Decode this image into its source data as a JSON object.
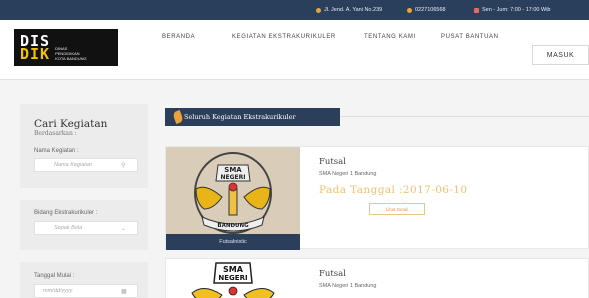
{
  "topbar": {
    "address": "Jl. Jend. A. Yani No.239",
    "phone": "0227106568",
    "hours": "Sen - Jum: 7:00 - 17:00 Wib"
  },
  "logo": {
    "mark_line1": "DIS",
    "mark_line2": "DIK",
    "text_line1": "Dinas",
    "text_line2": "Pendidikan",
    "text_line3": "Kota Bandung"
  },
  "nav": {
    "items": [
      "BERANDA",
      "KEGIATAN EKSTRAKURIKULER",
      "TENTANG KAMI",
      "PUSAT BANTUAN"
    ],
    "login_label": "MASUK"
  },
  "sidebar": {
    "title": "Cari Kegiatan",
    "subtitle": "Berdasarkan :",
    "name_label": "Nama Kegiatan :",
    "name_placeholder": "Nama Kegiatan",
    "field_label": "Bidang Ekstrakurikuler :",
    "field_value": "Sepak Bola",
    "date_label": "Tanggal Mulai :",
    "date_placeholder": "mm/dd/yyyy"
  },
  "section": {
    "title": "Seluruh Kegiatan Ekstrakurikuler"
  },
  "cards": [
    {
      "title": "Futsal",
      "school": "SMA Negeri 1 Bandung",
      "date_text": "Pada Tanggal :2017-06-10",
      "button": "Lihat Detail",
      "badge": "Futsalnistic",
      "emblem_top": "SMA",
      "emblem_mid": "NEGERI",
      "emblem_bottom": "BANDUNG"
    },
    {
      "title": "Futsal",
      "school": "SMA Negeri 1 Bandung",
      "emblem_top": "SMA",
      "emblem_mid": "NEGERI"
    }
  ],
  "colors": {
    "topbar": "#2a3f5c",
    "accent_gold": "#f0c070",
    "badge_navy": "#2b3e5a"
  },
  "icons": {
    "address": "map-pin-icon",
    "phone": "phone-icon",
    "hours": "calendar-icon",
    "search": "search-icon",
    "dropdown": "chevron-down-icon",
    "date": "calendar-icon"
  }
}
